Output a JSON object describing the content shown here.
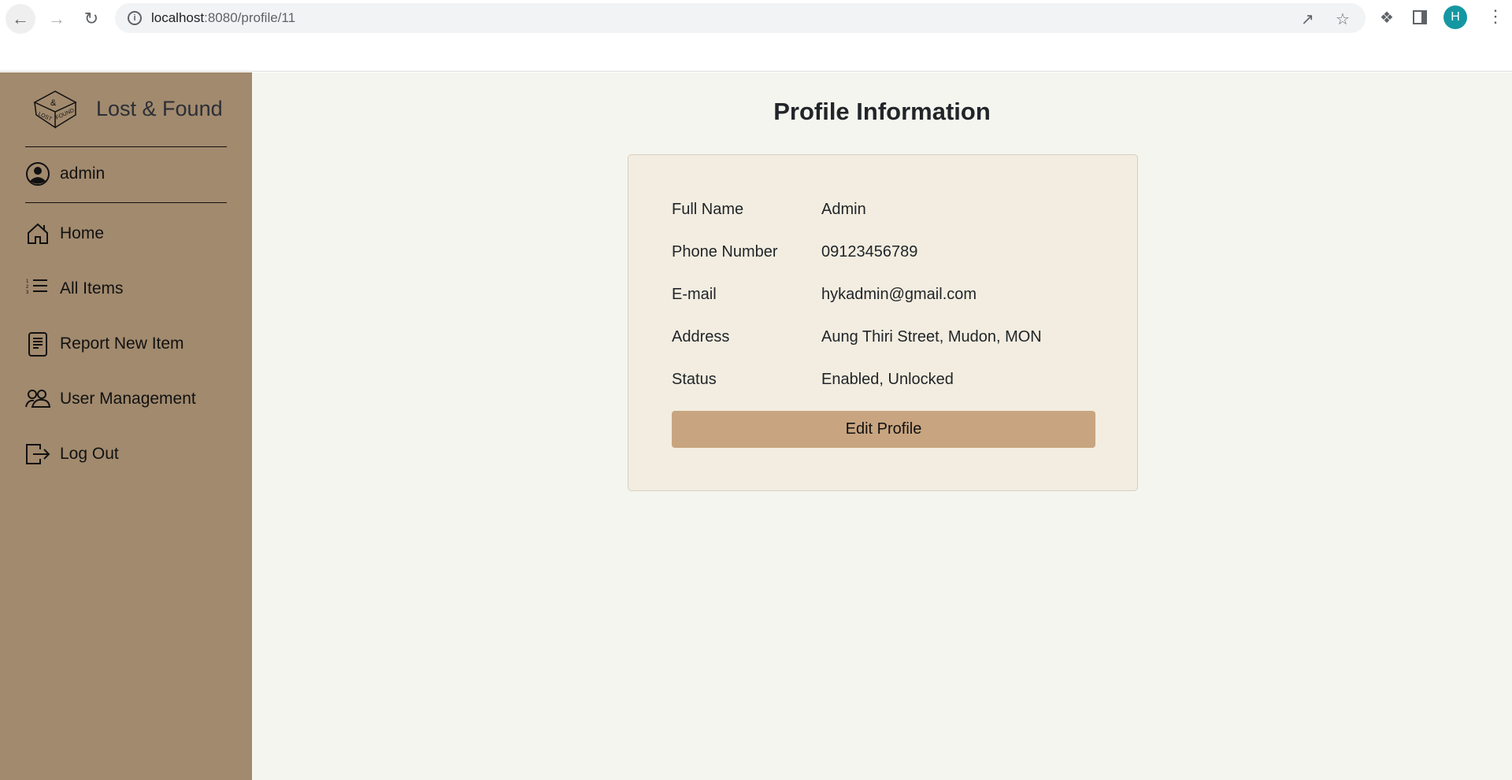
{
  "browser": {
    "url_host": "localhost",
    "url_path": ":8080/profile/11",
    "profile_initial": "H",
    "icons": [
      "back-icon",
      "forward-icon",
      "reload-icon",
      "info-icon",
      "share-icon",
      "star-icon",
      "extensions-icon",
      "side-panel-icon",
      "menu-icon"
    ]
  },
  "sidebar": {
    "brand": "Lost & Found",
    "user": "admin",
    "items": [
      {
        "label": "Home",
        "icon": "home-icon"
      },
      {
        "label": "All Items",
        "icon": "numbered-list-icon"
      },
      {
        "label": "Report New Item",
        "icon": "document-icon"
      },
      {
        "label": "User Management",
        "icon": "users-icon"
      },
      {
        "label": "Log Out",
        "icon": "logout-icon"
      }
    ]
  },
  "main": {
    "title": "Profile Information",
    "fields": [
      {
        "label": "Full Name",
        "value": "Admin"
      },
      {
        "label": "Phone Number",
        "value": "09123456789"
      },
      {
        "label": "E-mail",
        "value": "hykadmin@gmail.com"
      },
      {
        "label": "Address",
        "value": "Aung Thiri Street, Mudon, MON"
      },
      {
        "label": "Status",
        "value": "Enabled, Unlocked"
      }
    ],
    "edit_button": "Edit Profile"
  },
  "colors": {
    "sidebar": "#a28a6e",
    "background": "#f5f5ef",
    "card": "#f2ede0",
    "button": "#c8a580",
    "avatar": "#1597a2"
  }
}
